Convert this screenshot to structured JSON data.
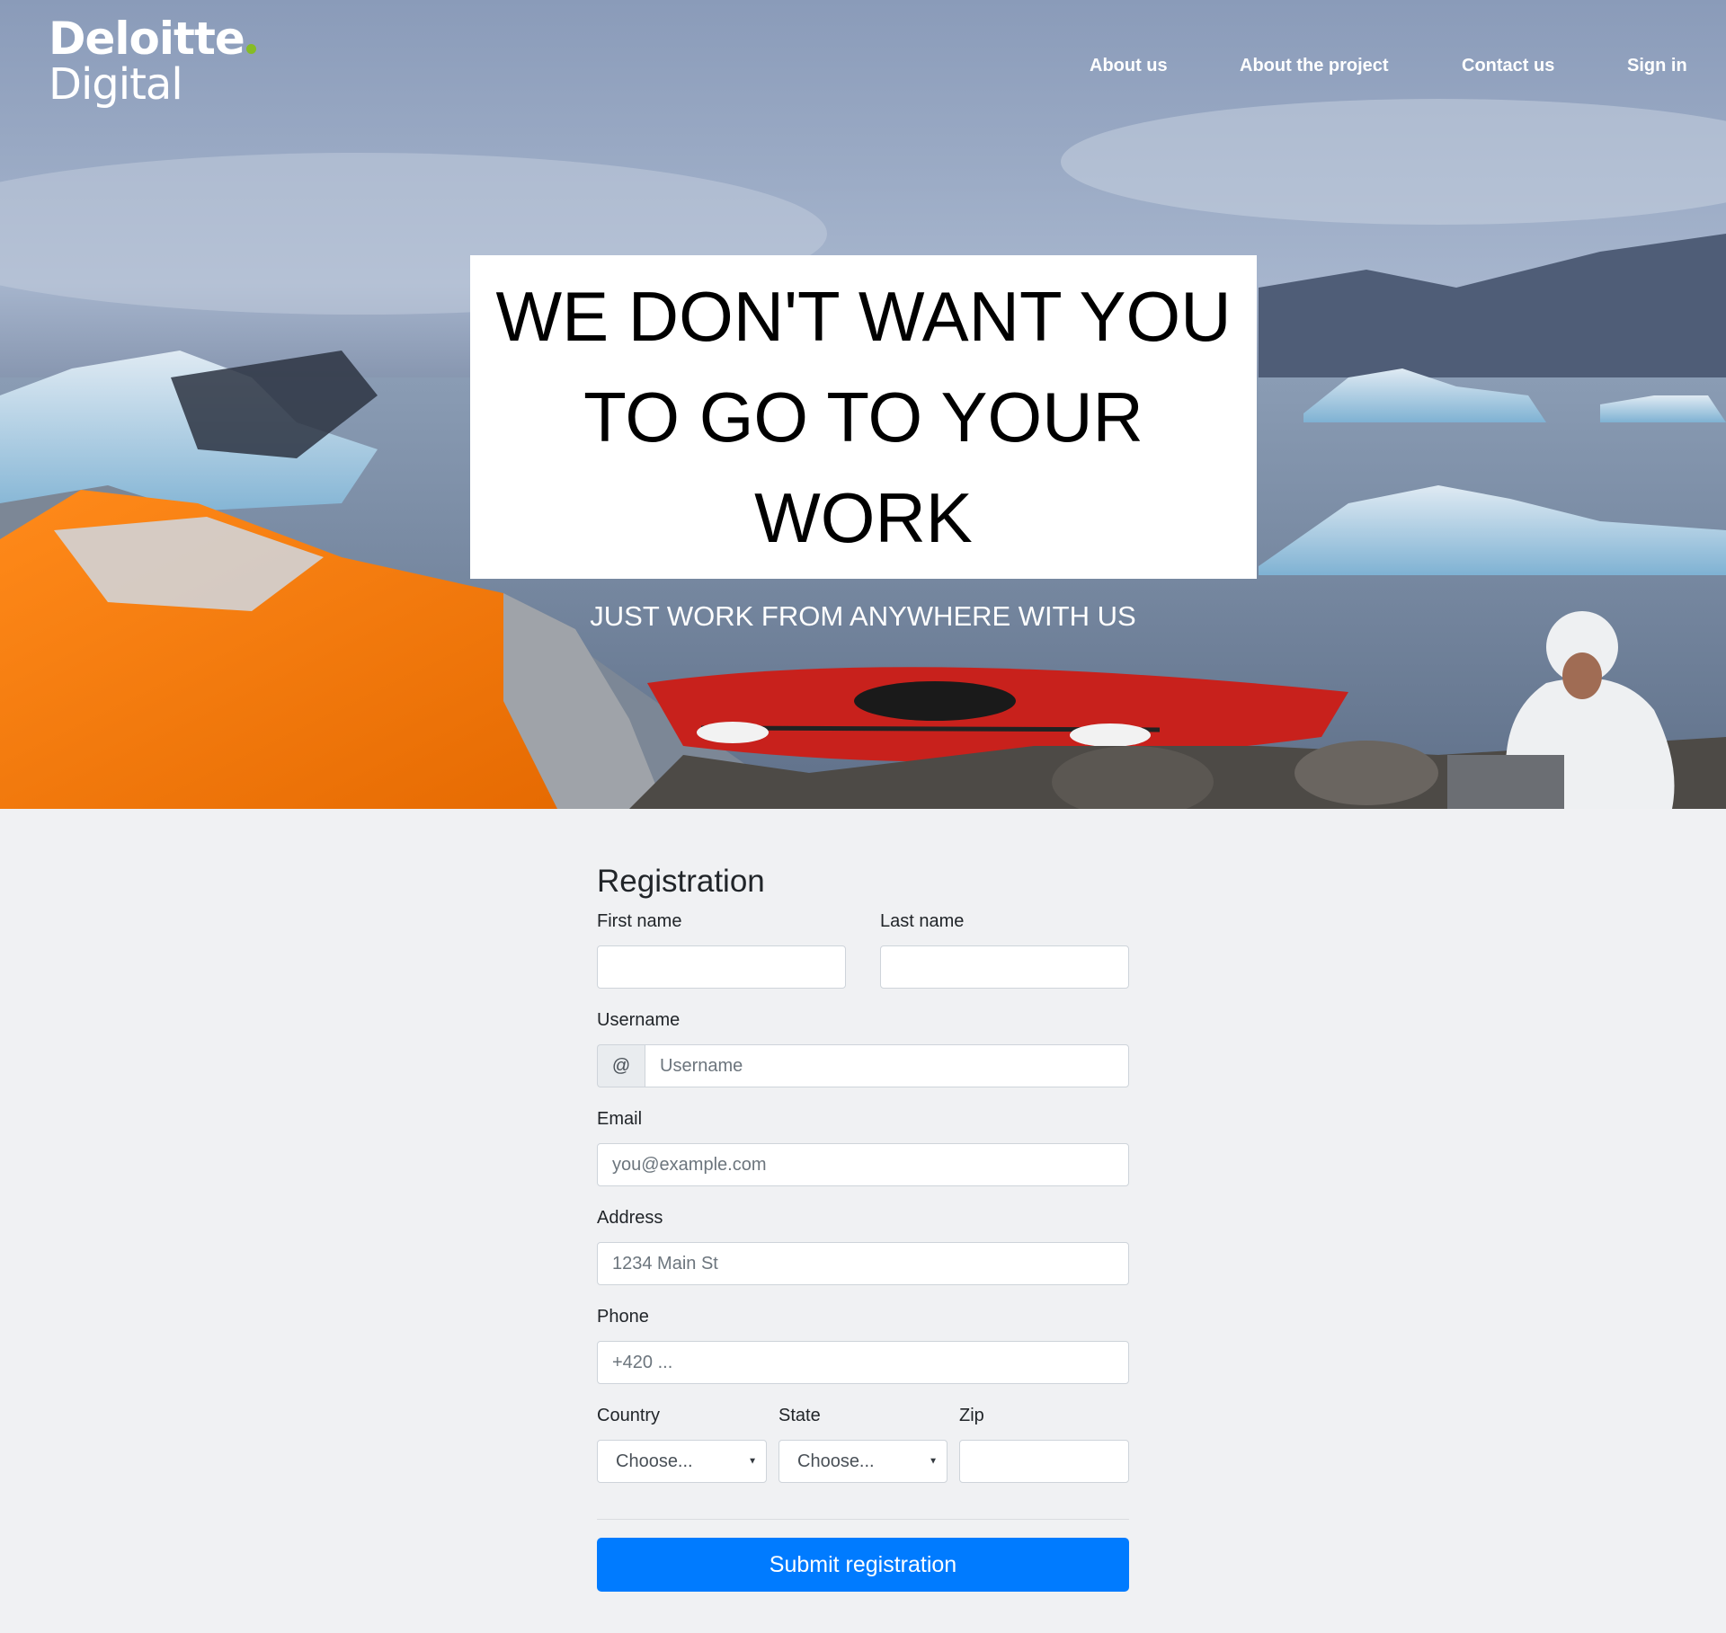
{
  "brand": {
    "line1": "Deloitte",
    "line2": "Digital",
    "dot_color": "#86bc25"
  },
  "nav": {
    "items": [
      "About us",
      "About the project",
      "Contact us",
      "Sign in"
    ]
  },
  "hero": {
    "headline": "WE DON'T WANT YOU TO GO TO YOUR WORK",
    "subheadline": "JUST WORK FROM ANYWHERE WITH US"
  },
  "form": {
    "title": "Registration",
    "first_name": {
      "label": "First name",
      "value": ""
    },
    "last_name": {
      "label": "Last name",
      "value": ""
    },
    "username": {
      "label": "Username",
      "prefix": "@",
      "placeholder": "Username"
    },
    "email": {
      "label": "Email",
      "placeholder": "you@example.com"
    },
    "address": {
      "label": "Address",
      "placeholder": "1234 Main St"
    },
    "phone": {
      "label": "Phone",
      "placeholder": "+420 ..."
    },
    "country": {
      "label": "Country",
      "selected": "Choose..."
    },
    "state": {
      "label": "State",
      "selected": "Choose..."
    },
    "zip": {
      "label": "Zip",
      "value": ""
    },
    "submit_label": "Submit registration"
  },
  "colors": {
    "accent": "#007bff",
    "page_bg": "#f0f1f3"
  }
}
